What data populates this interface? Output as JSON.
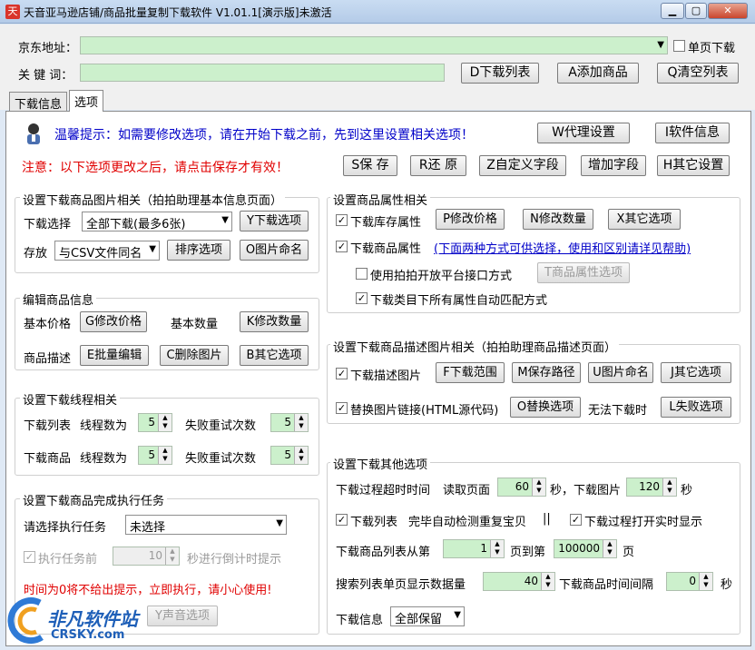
{
  "window": {
    "title": "天音亚马逊店铺/商品批量复制下载软件 V1.01.1[演示版]未激活",
    "min": "▁",
    "max": "▢",
    "close": "✕"
  },
  "top": {
    "jd_label": "京东地址：",
    "jd_value": "",
    "single_page_label": "单页下载",
    "keyword_label": "关 键 词：",
    "keyword_value": "",
    "download_list": "D下载列表",
    "add_goods": "A添加商品",
    "clear_list": "Q清空列表"
  },
  "tabs": [
    "下载信息",
    "选项"
  ],
  "notice": {
    "tip": "温馨提示：如需要修改选项，请在开始下载之前，先到这里设置相关选项！",
    "warn": "注意：以下选项更改之后，请点击保存才有效！",
    "proxy": "W代理设置",
    "software_info": "I软件信息",
    "save": "S保 存",
    "restore": "R还 原",
    "custom_field": "Z自定义字段",
    "add_field": "增加字段",
    "other_settings": "H其它设置"
  },
  "img_group": {
    "title": "设置下载商品图片相关（拍拍助理基本信息页面）",
    "download_choice_label": "下载选择",
    "download_choice_value": "全部下载(最多6张)",
    "download_option": "Y下载选项",
    "store_label": "存放",
    "store_value": "与CSV文件同名",
    "sort_option": "排序选项",
    "image_naming": "O图片命名"
  },
  "edit_group": {
    "title": "编辑商品信息",
    "base_price": "基本价格",
    "modify_price": "G修改价格",
    "base_qty": "基本数量",
    "modify_qty": "K修改数量",
    "desc": "商品描述",
    "batch_edit": "E批量编辑",
    "delete_image": "C删除图片",
    "other_options": "B其它选项"
  },
  "thread_group": {
    "title": "设置下载线程相关",
    "list_label": "下载列表",
    "threads_label": "线程数为",
    "list_threads": "5",
    "retry_label": "失败重试次数",
    "list_retry": "5",
    "goods_label": "下载商品",
    "goods_threads": "5",
    "goods_retry": "5"
  },
  "task_group": {
    "title": "设置下载商品完成执行任务",
    "choose_label": "请选择执行任务",
    "choose_value": "未选择",
    "exec_before": "执行任务前",
    "exec_seconds": "10",
    "countdown": "秒进行倒计时提示",
    "warning": "时间为0将不给出提示，立即执行，请小心使用!",
    "sound_option": "Y声音选项"
  },
  "attr_group": {
    "title": "设置商品属性相关",
    "stock_attr": "下载库存属性",
    "modify_price": "P修改价格",
    "modify_qty": "N修改数量",
    "other_options": "X其它选项",
    "goods_attr": "下载商品属性",
    "goods_attr_link": "(下面两种方式可供选择，使用和区别请详见帮助)",
    "open_api": "使用拍拍开放平台接口方式",
    "attr_option": "T商品属性选项",
    "auto_match": "下载类目下所有属性自动匹配方式"
  },
  "desc_group": {
    "title": "设置下载商品描述图片相关（拍拍助理商品描述页面）",
    "download_desc": "下载描述图片",
    "download_range": "F下载范围",
    "save_path": "M保存路径",
    "image_naming": "U图片命名",
    "other_options": "J其它选项",
    "replace_link": "替换图片链接(HTML源代码)",
    "replace_option": "O替换选项",
    "fail_label": "无法下载时",
    "fail_option": "L失败选项"
  },
  "other_group": {
    "title": "设置下载其他选项",
    "timeout_label": "下载过程超时时间",
    "read_page": "读取页面",
    "page_seconds": "60",
    "seconds_download_image": "秒，下载图片",
    "image_seconds": "120",
    "seconds": "秒",
    "download_list": "下载列表",
    "auto_detect": "完毕自动检测重复宝贝",
    "separator": "||",
    "realtime": "下载过程打开实时显示",
    "list_from": "下载商品列表从第",
    "from_value": "1",
    "page_to": "页到第",
    "to_value": "100000",
    "page": "页",
    "search_per_page": "搜索列表单页显示数据量",
    "per_page_value": "40",
    "interval_label": "下载商品时间间隔",
    "interval_value": "0",
    "interval_unit": "秒",
    "download_info": "下载信息",
    "download_info_value": "全部保留"
  },
  "watermark": {
    "cn": "非凡软件站",
    "en": "CRSKY.com"
  },
  "colors": {
    "green_field": "#ccf0cc",
    "red_text": "#e00000",
    "blue_text": "#0000c8"
  }
}
